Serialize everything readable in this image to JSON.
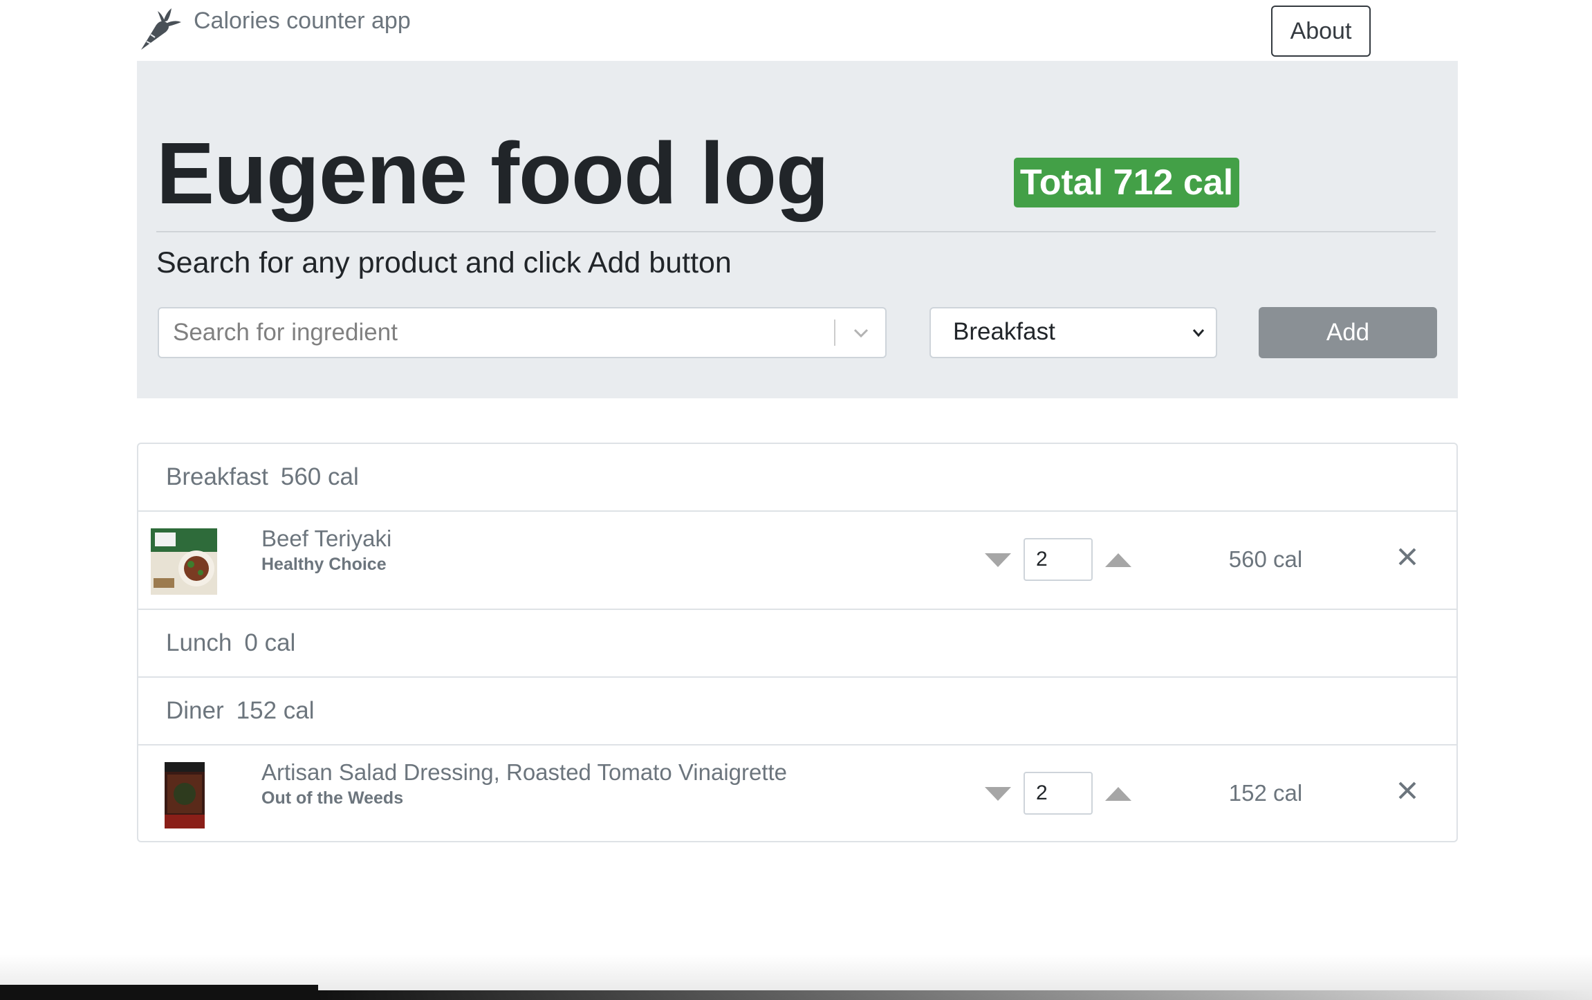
{
  "app": {
    "brand_icon": "carrot-icon",
    "brand_name": "Calories counter app",
    "about_label": "About"
  },
  "header": {
    "title": "Eugene food log",
    "total_label": "Total 712 cal",
    "subtitle": "Search for any product and click Add button"
  },
  "search": {
    "placeholder": "Search for ingredient",
    "value": "",
    "dropdown_icon": "chevron-down-icon"
  },
  "meal_select": {
    "selected": "Breakfast",
    "dropdown_icon": "chevron-down-icon"
  },
  "add_button": {
    "label": "Add"
  },
  "meals": {
    "breakfast": {
      "name": "Breakfast",
      "calories": "560 cal",
      "items": [
        {
          "name": "Beef Teriyaki",
          "brand": "Healthy Choice",
          "quantity": "2",
          "calories": "560 cal",
          "thumbnail_icon": "product-photo-icon"
        }
      ]
    },
    "lunch": {
      "name": "Lunch",
      "calories": "0 cal",
      "items": []
    },
    "diner": {
      "name": "Diner",
      "calories": "152 cal",
      "items": [
        {
          "name": "Artisan Salad Dressing, Roasted Tomato Vinaigrette",
          "brand": "Out of the Weeds",
          "quantity": "2",
          "calories": "152 cal",
          "thumbnail_icon": "product-photo-icon"
        }
      ]
    }
  },
  "icons": {
    "decrease": "caret-down-icon",
    "increase": "caret-up-icon",
    "remove": "close-icon"
  },
  "colors": {
    "total_badge": "#43a047",
    "jumbotron_bg": "#e9ecef",
    "add_button_bg": "#8a9095",
    "muted_text": "#6c757d"
  }
}
